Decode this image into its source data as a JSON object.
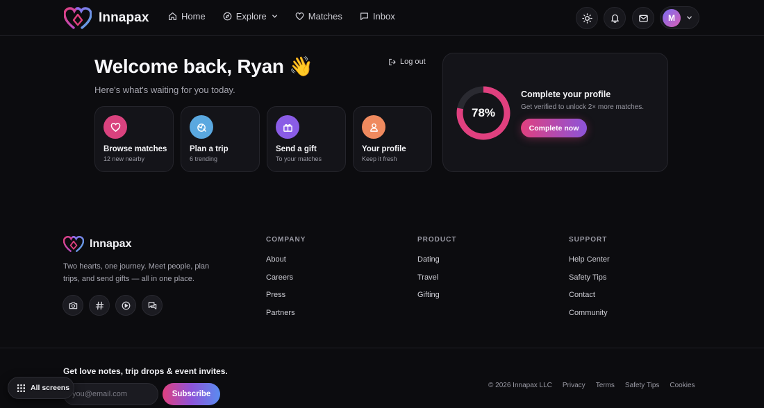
{
  "brand": {
    "name": "Innapax"
  },
  "nav": {
    "items": [
      {
        "label": "Home",
        "icon": "home-icon"
      },
      {
        "label": "Explore",
        "icon": "compass-icon"
      },
      {
        "label": "Matches",
        "icon": "heart-icon"
      },
      {
        "label": "Inbox",
        "icon": "message-icon"
      }
    ]
  },
  "header_actions": {
    "icons": [
      "sun-icon",
      "bell-icon",
      "mail-icon"
    ],
    "avatar_initial": "M"
  },
  "hero": {
    "title": "Welcome back, Ryan 👋",
    "subtitle": "Here's what's waiting for you today.",
    "logout_label": "Log out"
  },
  "cards": [
    {
      "title": "Browse matches",
      "subtitle": "12 new nearby",
      "icon": "heart-icon",
      "color": "#d9427e"
    },
    {
      "title": "Plan a trip",
      "subtitle": "6 trending",
      "icon": "plane-globe-icon",
      "color": "#5aa8e0"
    },
    {
      "title": "Send a gift",
      "subtitle": "To your matches",
      "icon": "gift-icon",
      "color": "#8a5ce6"
    },
    {
      "title": "Your profile",
      "subtitle": "Keep it fresh",
      "icon": "user-icon",
      "color": "#ef8a5f"
    }
  ],
  "profile": {
    "percent_label": "78%",
    "percent": 78,
    "title": "Complete your profile",
    "subtitle": "Get verified to unlock 2× more matches.",
    "cta": "Complete now",
    "ring_color": "#e0407f"
  },
  "footer": {
    "brand": "Innapax",
    "tagline": "Two hearts, one journey. Meet people, plan trips, and send gifts — all in one place.",
    "social_icons": [
      "camera-icon",
      "hashtag-icon",
      "play-icon",
      "chat-icon"
    ],
    "columns": [
      {
        "heading": "COMPANY",
        "links": [
          "About",
          "Careers",
          "Press",
          "Partners"
        ]
      },
      {
        "heading": "PRODUCT",
        "links": [
          "Dating",
          "Travel",
          "Gifting"
        ]
      },
      {
        "heading": "SUPPORT",
        "links": [
          "Help Center",
          "Safety Tips",
          "Contact",
          "Community"
        ]
      }
    ],
    "newsletter": {
      "title": "Get love notes, trip drops & event invites.",
      "placeholder": "you@email.com",
      "button": "Subscribe"
    },
    "copyright": "© 2026 Innapax LLC",
    "legal_links": [
      "Privacy",
      "Terms",
      "Safety Tips",
      "Cookies"
    ]
  },
  "floating": {
    "all_screens_label": "All screens"
  }
}
